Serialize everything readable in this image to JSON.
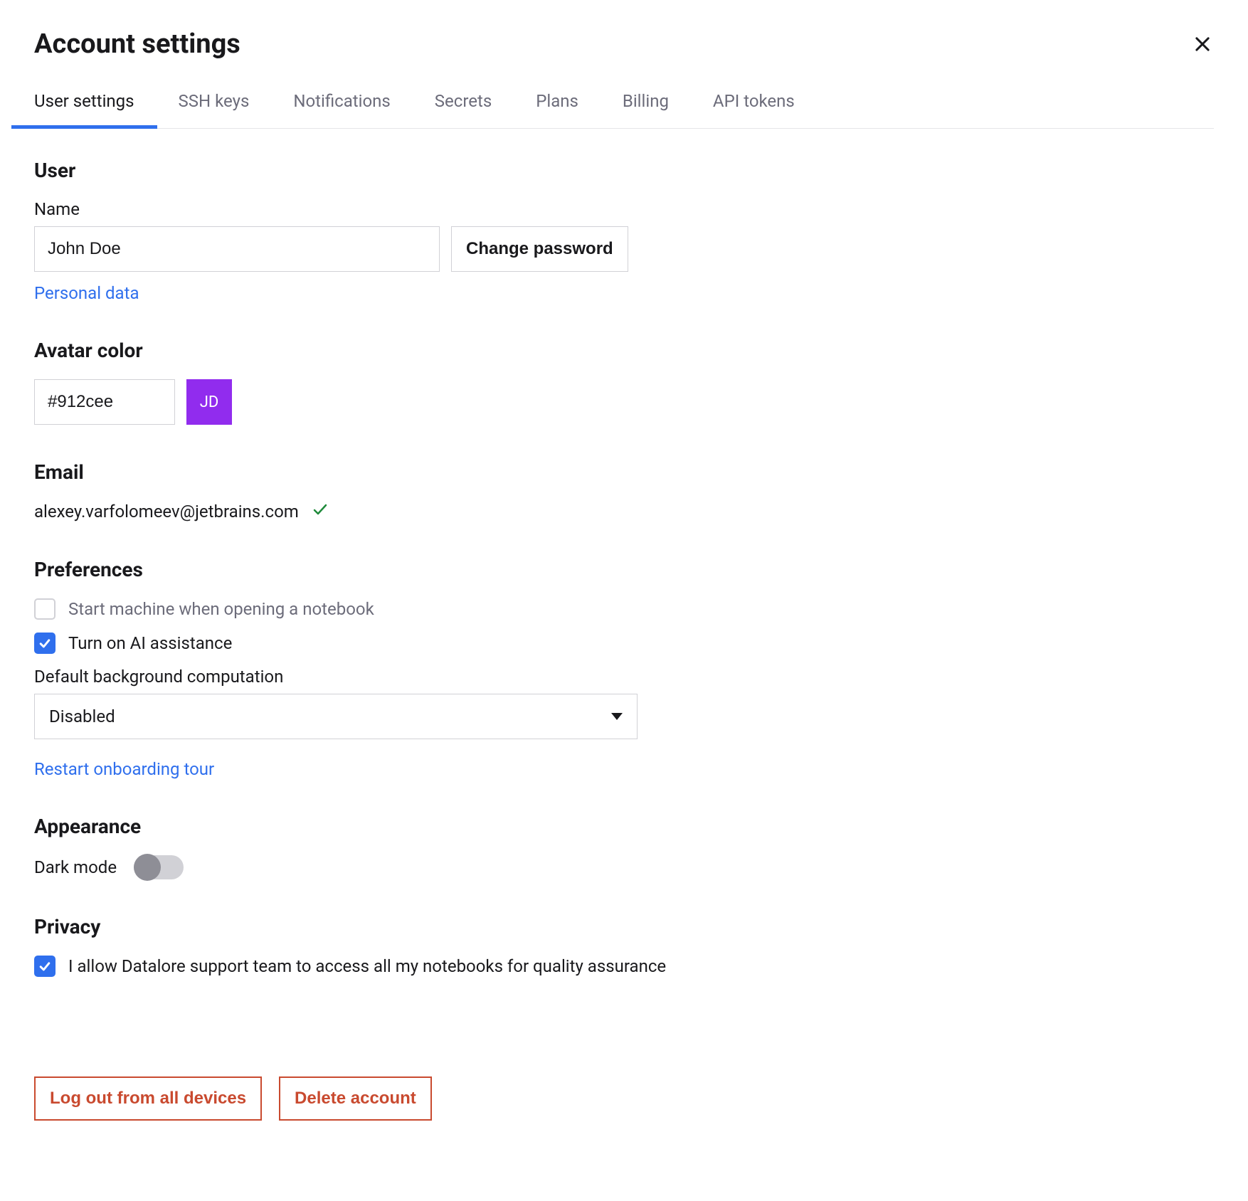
{
  "header": {
    "title": "Account settings"
  },
  "tabs": {
    "t0": "User settings",
    "t1": "SSH keys",
    "t2": "Notifications",
    "t3": "Secrets",
    "t4": "Plans",
    "t5": "Billing",
    "t6": "API tokens"
  },
  "user": {
    "heading": "User",
    "name_label": "Name",
    "name_value": "John Doe",
    "change_password": "Change password",
    "personal_data": "Personal data"
  },
  "avatar": {
    "heading": "Avatar color",
    "color_value": "#912cee",
    "initials": "JD",
    "swatch_color": "#912CEE"
  },
  "email": {
    "heading": "Email",
    "value": "alexey.varfolomeev@jetbrains.com"
  },
  "preferences": {
    "heading": "Preferences",
    "start_machine": "Start machine when opening a notebook",
    "ai_assist": "Turn on AI assistance",
    "bg_comp_label": "Default background computation",
    "bg_comp_value": "Disabled",
    "restart_tour": "Restart onboarding tour"
  },
  "appearance": {
    "heading": "Appearance",
    "dark_mode": "Dark mode"
  },
  "privacy": {
    "heading": "Privacy",
    "allow_support": "I allow Datalore support team to access all my notebooks for quality assurance"
  },
  "actions": {
    "logout_all": "Log out from all devices",
    "delete_account": "Delete account"
  }
}
